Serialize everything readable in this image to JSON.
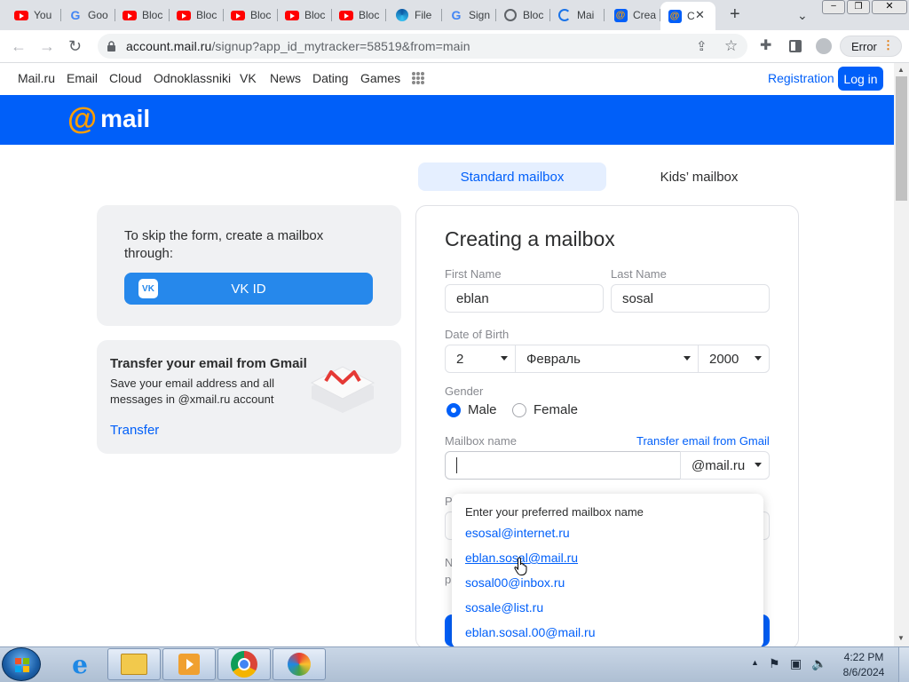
{
  "browser": {
    "tabs": [
      {
        "label": "You",
        "icon": "youtube-icon"
      },
      {
        "label": "Goo",
        "icon": "google-icon"
      },
      {
        "label": "Bloc",
        "icon": "youtube-icon"
      },
      {
        "label": "Bloc",
        "icon": "youtube-icon"
      },
      {
        "label": "Bloc",
        "icon": "youtube-icon"
      },
      {
        "label": "Bloc",
        "icon": "youtube-icon"
      },
      {
        "label": "Bloc",
        "icon": "youtube-icon"
      },
      {
        "label": "File",
        "icon": "edge-icon"
      },
      {
        "label": "Sign",
        "icon": "google-icon"
      },
      {
        "label": "Bloc",
        "icon": "globe-icon"
      },
      {
        "label": "Mai",
        "icon": "loading-icon"
      },
      {
        "label": "Crea",
        "icon": "mail-at-icon"
      },
      {
        "label": "C",
        "icon": "mail-at-icon"
      }
    ],
    "url_host": "account.mail.ru",
    "url_rest": "/signup?app_id_mytracker=58519&from=main",
    "error_label": "Error"
  },
  "mailnav": {
    "links": [
      "Mail.ru",
      "Email",
      "Cloud",
      "Odnoklassniki",
      "VK",
      "News",
      "Dating",
      "Games"
    ],
    "registration": "Registration",
    "login": "Log in"
  },
  "header": {
    "logo_text": "mail",
    "logo_at": "@"
  },
  "tabs": {
    "standard": "Standard mailbox",
    "kids": "Kids’ mailbox"
  },
  "vk": {
    "text": "To skip the form, create a mailbox through:",
    "button": "VK ID",
    "logo": "VK"
  },
  "gmail_card": {
    "title": "Transfer your email from Gmail",
    "desc": "Save your email address and all messages in @xmail.ru account",
    "link": "Transfer"
  },
  "form": {
    "title": "Creating a mailbox",
    "first_name_label": "First Name",
    "first_name": "eblan",
    "last_name_label": "Last Name",
    "last_name": "sosal",
    "dob_label": "Date of Birth",
    "day": "2",
    "month": "Февраль",
    "year": "2000",
    "gender_label": "Gender",
    "male": "Male",
    "female": "Female",
    "mailbox_label": "Mailbox name",
    "gmail_link": "Transfer email from Gmail",
    "domain": "@mail.ru",
    "mailbox_value": "",
    "partial_p1": "P",
    "partial_n": "N",
    "partial_p2": "p"
  },
  "suggestions": {
    "hint": "Enter your preferred mailbox name",
    "options": [
      "esosal@internet.ru",
      "eblan.sosal@mail.ru",
      "sosal00@inbox.ru",
      "sosale@list.ru",
      "eblan.sosal.00@mail.ru"
    ]
  },
  "taskbar": {
    "time": "4:22 PM",
    "date": "8/6/2024"
  }
}
